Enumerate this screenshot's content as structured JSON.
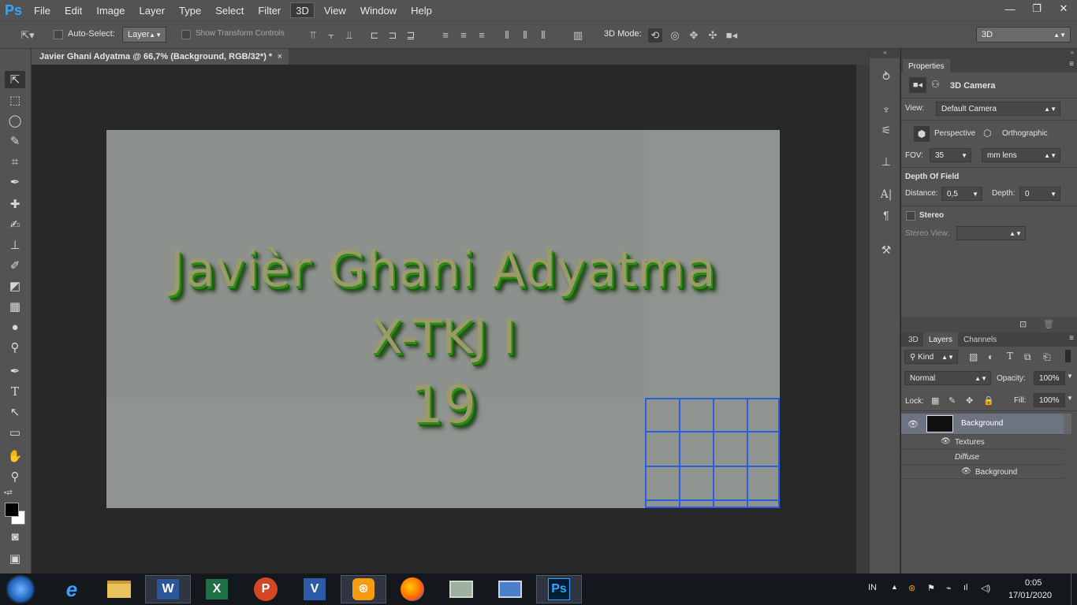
{
  "app": {
    "logo": "Ps"
  },
  "menu": [
    "File",
    "Edit",
    "Image",
    "Layer",
    "Type",
    "Select",
    "Filter",
    "3D",
    "View",
    "Window",
    "Help"
  ],
  "menu_active": "3D",
  "window_controls": {
    "minimize": "—",
    "restore": "❐",
    "close": "✕"
  },
  "options": {
    "auto_select_label": "Auto-Select:",
    "auto_select_value": "Layer",
    "show_transform_label": "Show Transform Controls",
    "mode_label": "3D Mode:",
    "workspace_value": "3D"
  },
  "document": {
    "tab_title": "Javier Ghani Adyatma @ 66,7% (Background, RGB/32*) *",
    "close": "×"
  },
  "canvas_text": {
    "line1": "Javièr Ghani Adyatma",
    "line2": "X-TKJ I",
    "line3": "19"
  },
  "properties": {
    "tab": "Properties",
    "type_label": "3D Camera",
    "view_label": "View:",
    "view_value": "Default Camera",
    "perspective_label": "Perspective",
    "orthographic_label": "Orthographic",
    "fov_label": "FOV:",
    "fov_value": "35",
    "fov_unit": "mm lens",
    "dof_heading": "Depth Of Field",
    "distance_label": "Distance:",
    "distance_value": "0,5",
    "depth_label": "Depth:",
    "depth_value": "0",
    "stereo_label": "Stereo",
    "stereo_view_label": "Stereo View:"
  },
  "layers_panel": {
    "tabs": [
      "3D",
      "Layers",
      "Channels"
    ],
    "active_tab": "Layers",
    "filter_value": "Kind",
    "blend_mode": "Normal",
    "opacity_label": "Opacity:",
    "opacity_value": "100%",
    "lock_label": "Lock:",
    "fill_label": "Fill:",
    "fill_value": "100%",
    "rows": {
      "layer": "Background",
      "textures": "Textures",
      "diffuse": "Diffuse",
      "sub_layer": "Background"
    }
  },
  "taskbar": {
    "lang": "IN",
    "time": "0:05",
    "date": "17/01/2020",
    "apps": [
      "Start",
      "Internet Explorer",
      "File Explorer",
      "Word",
      "Excel",
      "PowerPoint",
      "Visio",
      "UC Browser",
      "Firefox",
      "Network Monitor",
      "Remote Desktop",
      "Photoshop"
    ],
    "active_app": "Photoshop"
  }
}
